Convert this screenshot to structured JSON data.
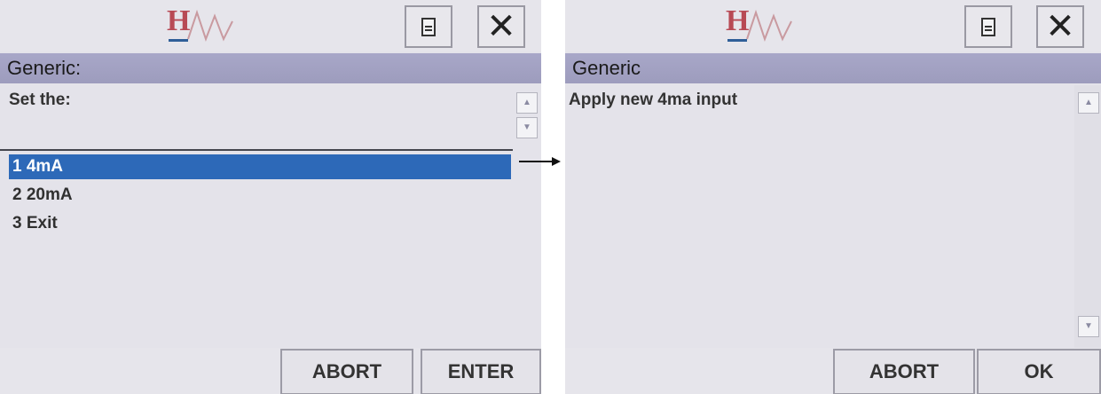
{
  "left_screen": {
    "title": "Generic:",
    "prompt": "Set the:",
    "menu_items": [
      {
        "label": "1 4mA",
        "selected": true
      },
      {
        "label": "2 20mA",
        "selected": false
      },
      {
        "label": "3 Exit",
        "selected": false
      }
    ],
    "buttons": {
      "abort": "ABORT",
      "enter": "ENTER"
    }
  },
  "right_screen": {
    "title": "Generic",
    "message": "Apply new 4ma input",
    "buttons": {
      "abort": "ABORT",
      "ok": "OK"
    }
  },
  "header": {
    "logo_letter": "H",
    "close_symbol": "✕",
    "icons": [
      "document-icon",
      "close-icon"
    ]
  },
  "colors": {
    "title_band": "#a8a7c8",
    "selection": "#2d69b8",
    "logo_red": "#b84a55",
    "logo_blue": "#2f5e98"
  }
}
